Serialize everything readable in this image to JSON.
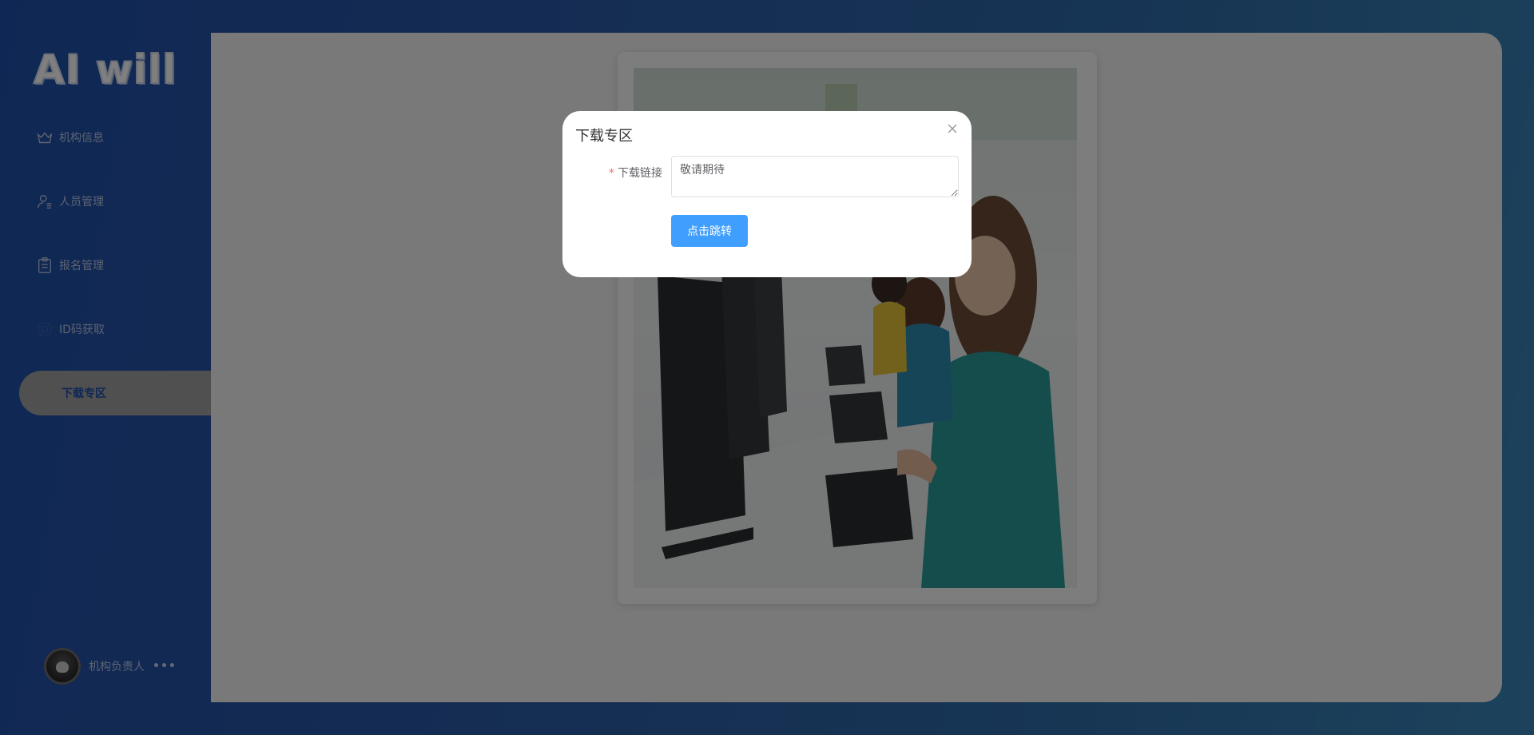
{
  "brand": {
    "logo_text": "AI will"
  },
  "sidebar": {
    "items": [
      {
        "label": "机构信息",
        "icon": "crown-icon"
      },
      {
        "label": "人员管理",
        "icon": "user-icon"
      },
      {
        "label": "报名管理",
        "icon": "clipboard-icon"
      },
      {
        "label": "ID码获取",
        "icon": "target-icon"
      },
      {
        "label": "下载专区",
        "active": true
      }
    ]
  },
  "user": {
    "name": "机构负责人",
    "more": "•••"
  },
  "dialog": {
    "title": "下载专区",
    "field_label": "下载链接",
    "required_mark": "*",
    "field_value": "敬请期待",
    "button_label": "点击跳转"
  },
  "colors": {
    "sidebar_bg": "#1f4fa8",
    "primary": "#409eff",
    "required": "#f56c6c"
  }
}
